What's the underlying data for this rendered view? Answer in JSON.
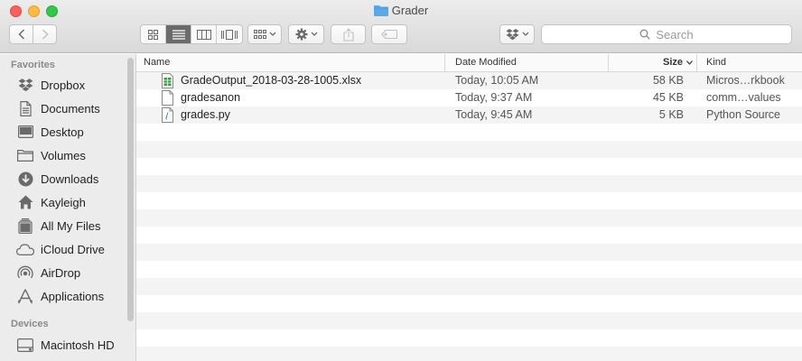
{
  "window": {
    "title": "Grader"
  },
  "toolbar": {
    "view_modes": [
      "icon-view",
      "list-view",
      "column-view",
      "cover-flow-view"
    ],
    "active_view": "list-view",
    "search_placeholder": "Search"
  },
  "sidebar": {
    "favorites_header": "Favorites",
    "favorites": [
      {
        "label": "Dropbox",
        "icon": "dropbox-icon"
      },
      {
        "label": "Documents",
        "icon": "documents-icon"
      },
      {
        "label": "Desktop",
        "icon": "desktop-icon"
      },
      {
        "label": "Volumes",
        "icon": "folder-icon"
      },
      {
        "label": "Downloads",
        "icon": "downloads-icon"
      },
      {
        "label": "Kayleigh",
        "icon": "home-icon"
      },
      {
        "label": "All My Files",
        "icon": "all-files-icon"
      },
      {
        "label": "iCloud Drive",
        "icon": "icloud-icon"
      },
      {
        "label": "AirDrop",
        "icon": "airdrop-icon"
      },
      {
        "label": "Applications",
        "icon": "applications-icon"
      }
    ],
    "devices_header": "Devices",
    "devices": [
      {
        "label": "Macintosh HD",
        "icon": "hard-drive-icon"
      }
    ]
  },
  "columns": {
    "name": "Name",
    "date_modified": "Date Modified",
    "size": "Size",
    "kind": "Kind"
  },
  "files": [
    {
      "name": "GradeOutput_2018-03-28-1005.xlsx",
      "date": "Today, 10:05 AM",
      "size": "58 KB",
      "kind": "Micros…rkbook",
      "icon": "spreadsheet-file-icon"
    },
    {
      "name": "gradesanon",
      "date": "Today, 9:37 AM",
      "size": "45 KB",
      "kind": "comm…values",
      "icon": "document-file-icon"
    },
    {
      "name": "grades.py",
      "date": "Today, 9:45 AM",
      "size": "5 KB",
      "kind": "Python Source",
      "icon": "python-file-icon"
    }
  ],
  "colors": {
    "folder_blue": "#5aa9e6",
    "spreadsheet_green": "#3f9a4a",
    "selected_view": "#6b6b6b"
  }
}
